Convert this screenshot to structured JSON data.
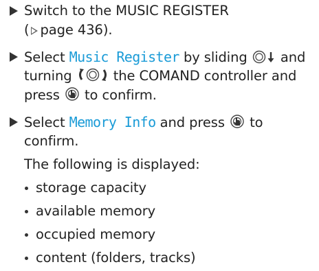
{
  "steps": [
    {
      "text": "Switch to the MUSIC REGISTER",
      "ref_page": "page 436",
      "ref_open": "(",
      "ref_close": ")."
    },
    {
      "prefix": "Select",
      "display_item": "Music Register",
      "text_mid": "by sliding",
      "text_and": "and",
      "text_turning": "turning",
      "text_controller": "the COMAND controller and",
      "text_press": "press",
      "text_confirm": "to confirm."
    },
    {
      "prefix": "Select",
      "display_item": "Memory Info",
      "text_press": "and press",
      "text_to": "to",
      "text_confirm": "confirm.",
      "followup": "The following is displayed:"
    }
  ],
  "bullets": [
    "storage capacity",
    "available memory",
    "occupied memory",
    "content (folders, tracks)"
  ],
  "icons": {
    "step": "triangle-right-icon",
    "reference": "page-reference-arrow-icon",
    "slide_down": "controller-slide-down-icon",
    "turn": "controller-turn-icon",
    "press": "controller-press-icon"
  },
  "colors": {
    "text": "#222222",
    "display_text": "#1a9bd7"
  }
}
